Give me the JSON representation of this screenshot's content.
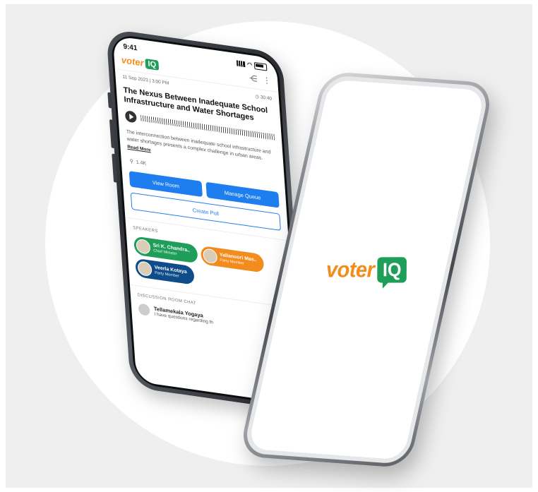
{
  "status_bar": {
    "time": "9:41"
  },
  "app": {
    "brand_left": "voter",
    "brand_right": "IQ"
  },
  "article": {
    "date": "11 Sep 2023 | 3:00 PM",
    "duration": "30:40",
    "title": "The Nexus Between Inadequate School Infrastructure and Water Shortages",
    "description": "The interconnection between inadequate school infrastructure and water shortages presents a complex challenge in urban areas.",
    "read_more": "Read More",
    "listeners": "1.4K"
  },
  "actions": {
    "view_room": "View Room",
    "manage_queue": "Manage Queue",
    "create_poll": "Create Poll"
  },
  "speakers": {
    "heading": "SPEAKERS",
    "items": [
      {
        "name": "Sri K. Chandra..",
        "role": "Chief Minister",
        "color": "#1f9e5a"
      },
      {
        "name": "Yallanoori Mas..",
        "role": "Party Member",
        "color": "#f28c1c"
      },
      {
        "name": "Veerla Kotaya",
        "role": "Party Member",
        "color": "#0f4c8a"
      }
    ]
  },
  "chat": {
    "heading": "DISCUSSION ROOM CHAT",
    "items": [
      {
        "name": "Tellamekala Yogaya",
        "text": "I have questions regarding th"
      }
    ]
  },
  "splash": {
    "brand_left": "voter",
    "brand_right": "IQ"
  }
}
